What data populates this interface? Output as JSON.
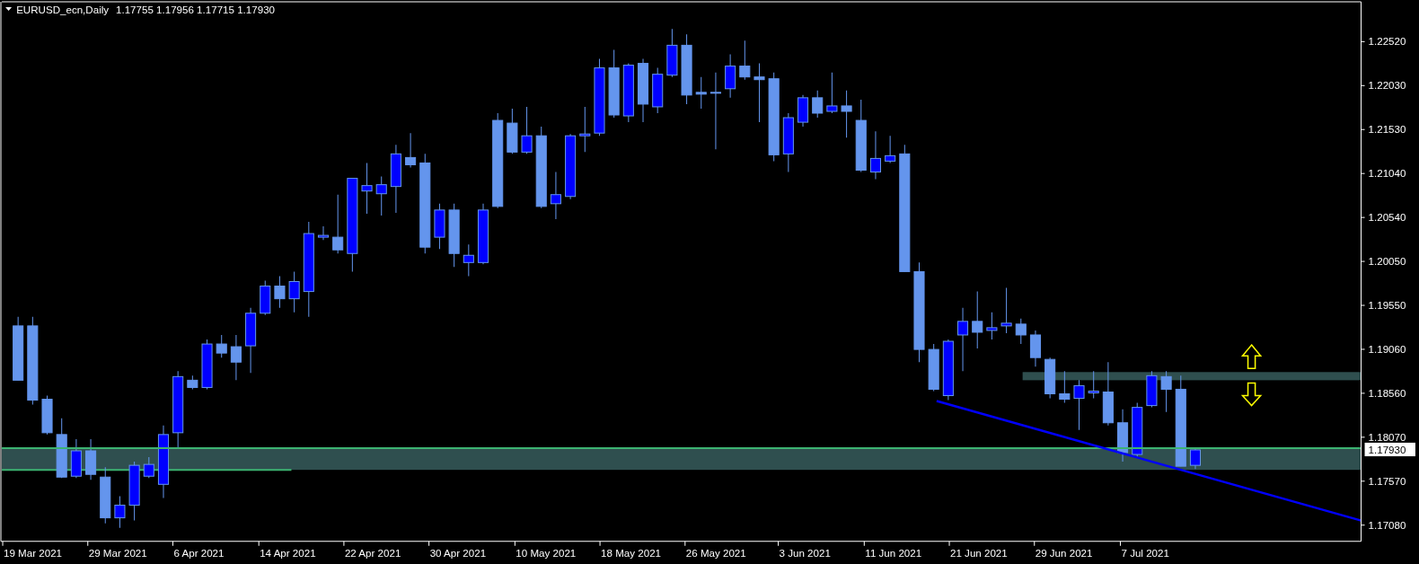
{
  "header": {
    "symbol": "EURUSD_ecn,Daily",
    "ohlc": "1.17755 1.17956 1.17715 1.17930"
  },
  "price_axis": [
    "1.22520",
    "1.22030",
    "1.21530",
    "1.21040",
    "1.20540",
    "1.20050",
    "1.19550",
    "1.19060",
    "1.18560",
    "1.18070",
    "1.17570",
    "1.17080"
  ],
  "current_price": "1.17930",
  "date_axis": [
    "19 Mar 2021",
    "29 Mar 2021",
    "6 Apr 2021",
    "14 Apr 2021",
    "22 Apr 2021",
    "30 Apr 2021",
    "10 May 2021",
    "18 May 2021",
    "26 May 2021",
    "3 Jun 2021",
    "11 Jun 2021",
    "21 Jun 2021",
    "29 Jun 2021",
    "7 Jul 2021"
  ]
}
